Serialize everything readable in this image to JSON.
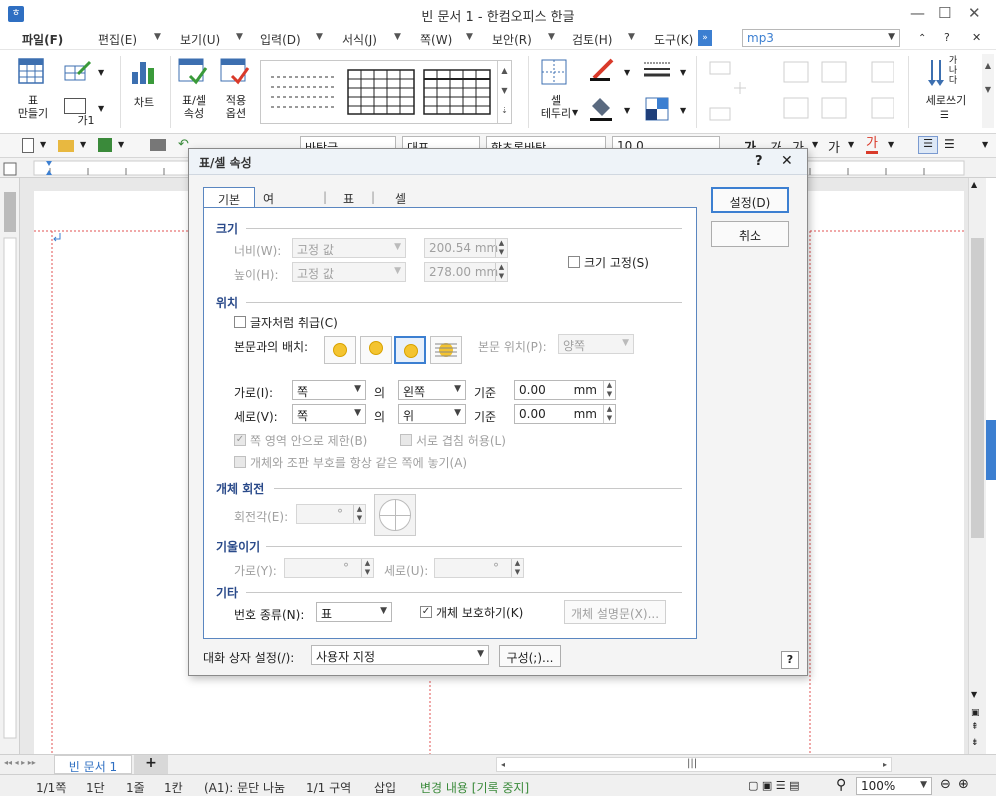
{
  "window": {
    "title": "빈 문서 1 - 한컴오피스 한글"
  },
  "menu": {
    "items": [
      "파일(F)",
      "편집(E)",
      "보기(U)",
      "입력(D)",
      "서식(J)",
      "쪽(W)",
      "보안(R)",
      "검토(H)",
      "도구(K)"
    ],
    "search_value": "mp3"
  },
  "ribbon": {
    "table_make": "표\n만들기",
    "chart": "차트",
    "cell_props": "표/셀\n속성",
    "apply_options": "적용\n옵션",
    "cell_border": "셀\n테두리",
    "vertical_write": "세로쓰기",
    "vertical_glyph": "가\n나\n다",
    "ga1": "가1"
  },
  "toolbar2": {
    "style": "바탕글",
    "font_face": "대표",
    "font_name": "함초롬바탕",
    "font_size": "10.0"
  },
  "dialog": {
    "title": "표/셀 속성",
    "tabs": [
      "기본",
      "여백/캡션",
      "표",
      "셀"
    ],
    "ok": "설정(D)",
    "cancel": "취소",
    "size": {
      "section": "크기",
      "width_label": "너비(W):",
      "width_mode": "고정 값",
      "width_value": "200.54",
      "height_label": "높이(H):",
      "height_mode": "고정 값",
      "height_value": "278.00",
      "unit": "mm",
      "fix_size": "크기 고정(S)"
    },
    "position": {
      "section": "위치",
      "treat_as_char": "글자처럼 취급(C)",
      "layout_label": "본문과의 배치:",
      "body_pos_label": "본문 위치(P):",
      "body_pos_value": "양쪽",
      "horiz_label": "가로(I):",
      "horiz_ref": "쪽",
      "horiz_align": "왼쪽",
      "vert_label": "세로(V):",
      "vert_ref": "쪽",
      "vert_align": "위",
      "of": "의",
      "base": "기준",
      "horiz_offset": "0.00",
      "vert_offset": "0.00",
      "unit": "mm",
      "limit_in_page": "쪽 영역 안으로 제한(B)",
      "allow_overlap": "서로 겹침 허용(L)",
      "keep_same_page": "개체와 조판 부호를 항상 같은 쪽에 놓기(A)"
    },
    "rotation": {
      "section": "개체 회전",
      "angle_label": "회전각(E):",
      "deg": "°"
    },
    "skew": {
      "section": "기울이기",
      "horiz_label": "가로(Y):",
      "vert_label": "세로(U):",
      "deg": "°"
    },
    "etc": {
      "section": "기타",
      "numbering_label": "번호 종류(N):",
      "numbering_value": "표",
      "protect": "개체 보호하기(K)",
      "desc_button": "개체 설명문(X)..."
    },
    "footer": {
      "setting_label": "대화 상자 설정(/):",
      "setting_value": "사용자 지정",
      "config_button": "구성(;)..."
    },
    "help": "?"
  },
  "doc_tab": "빈 문서 1",
  "status": {
    "page": "1/1쪽",
    "column": "1단",
    "line": "1줄",
    "char": "1칸",
    "cell": "(A1): 문단 나눔",
    "section": "1/1 구역",
    "insert": "삽입",
    "track": "변경 내용 [기록 중지]",
    "zoom": "100%"
  },
  "colors": {
    "accent": "#3c7fd1",
    "section_text": "#2a4a8a",
    "track_text": "#3a8a3a"
  }
}
